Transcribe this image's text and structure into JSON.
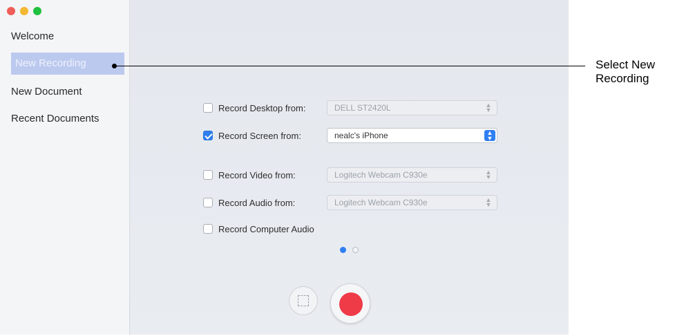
{
  "sidebar": {
    "items": [
      {
        "label": "Welcome"
      },
      {
        "label": "New Recording",
        "selected": true
      },
      {
        "label": "New Document"
      },
      {
        "label": "Recent Documents"
      }
    ]
  },
  "options": {
    "desktop": {
      "label": "Record Desktop from:",
      "checked": false,
      "value": "DELL ST2420L"
    },
    "screen": {
      "label": "Record Screen from:",
      "checked": true,
      "value": "nealc's iPhone"
    },
    "video": {
      "label": "Record Video from:",
      "checked": false,
      "value": "Logitech Webcam C930e"
    },
    "audio": {
      "label": "Record Audio from:",
      "checked": false,
      "value": "Logitech Webcam C930e"
    },
    "computer_audio": {
      "label": "Record Computer Audio",
      "checked": false
    }
  },
  "page_indicator": {
    "current": 1,
    "total": 2
  },
  "controls": {
    "area_icon": "selection-area-icon",
    "record_icon": "record-icon"
  },
  "callout": {
    "text_line1": "Select New",
    "text_line2": "Recording"
  },
  "colors": {
    "accent": "#2f7ff2",
    "record": "#ef3a48",
    "sidebar_selected": "#bcc9ef"
  }
}
